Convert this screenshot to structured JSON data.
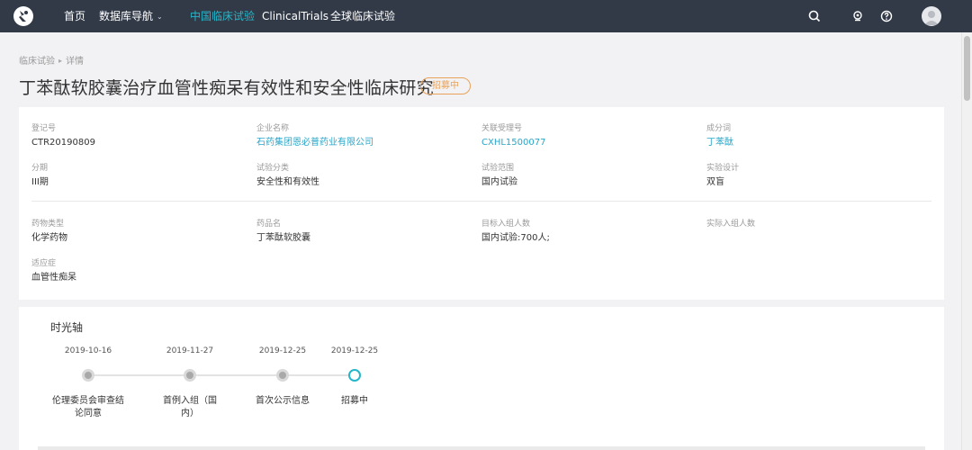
{
  "topnav": {
    "items": [
      {
        "label": "首页"
      },
      {
        "label": "数据库导航"
      },
      {
        "label": "中国临床试验"
      },
      {
        "label": "ClinicalTrials"
      },
      {
        "label": "全球临床试验"
      }
    ],
    "active_color": "#25b6c9",
    "bar_color": "#323a48",
    "icons": [
      "search-icon",
      "notification-icon",
      "help-icon",
      "user-avatar"
    ]
  },
  "breadcrumb": {
    "items": [
      "临床试验",
      "详情"
    ]
  },
  "page": {
    "title": "丁苯酞软胶囊治疗血管性痴呆有效性和安全性临床研究",
    "status": "招募中",
    "status_color": "#e8a25a"
  },
  "info": {
    "reg_no": {
      "label": "登记号",
      "value": "CTR20190809"
    },
    "company": {
      "label": "企业名称",
      "value": "石药集团恩必普药业有限公司"
    },
    "related_no": {
      "label": "关联受理号",
      "value": "CXHL1500077"
    },
    "ingredient": {
      "label": "成分词",
      "value": "丁苯酞"
    },
    "phase": {
      "label": "分期",
      "value": "III期"
    },
    "trial_category": {
      "label": "试验分类",
      "value": "安全性和有效性"
    },
    "trial_scope": {
      "label": "试验范围",
      "value": "国内试验"
    },
    "design": {
      "label": "实验设计",
      "value": "双盲"
    },
    "drug_type": {
      "label": "药物类型",
      "value": "化学药物"
    },
    "drug_name": {
      "label": "药品名",
      "value": "丁苯酞软胶囊"
    },
    "target_enrollment": {
      "label": "目标入组人数",
      "value": "国内试验:700人;"
    },
    "actual_enrollment": {
      "label": "实际入组人数",
      "value": ""
    },
    "indication": {
      "label": "适应症",
      "value": "血管性痴呆"
    }
  },
  "timeline": {
    "title": "时光轴",
    "events": [
      {
        "date": "2019-10-16",
        "label": "伦理委员会审查结论同意"
      },
      {
        "date": "2019-11-27",
        "label": "首例入组（国内）"
      },
      {
        "date": "2019-12-25",
        "label": "首次公示信息"
      },
      {
        "date": "2019-12-25",
        "label": "招募中",
        "current": true
      }
    ]
  }
}
